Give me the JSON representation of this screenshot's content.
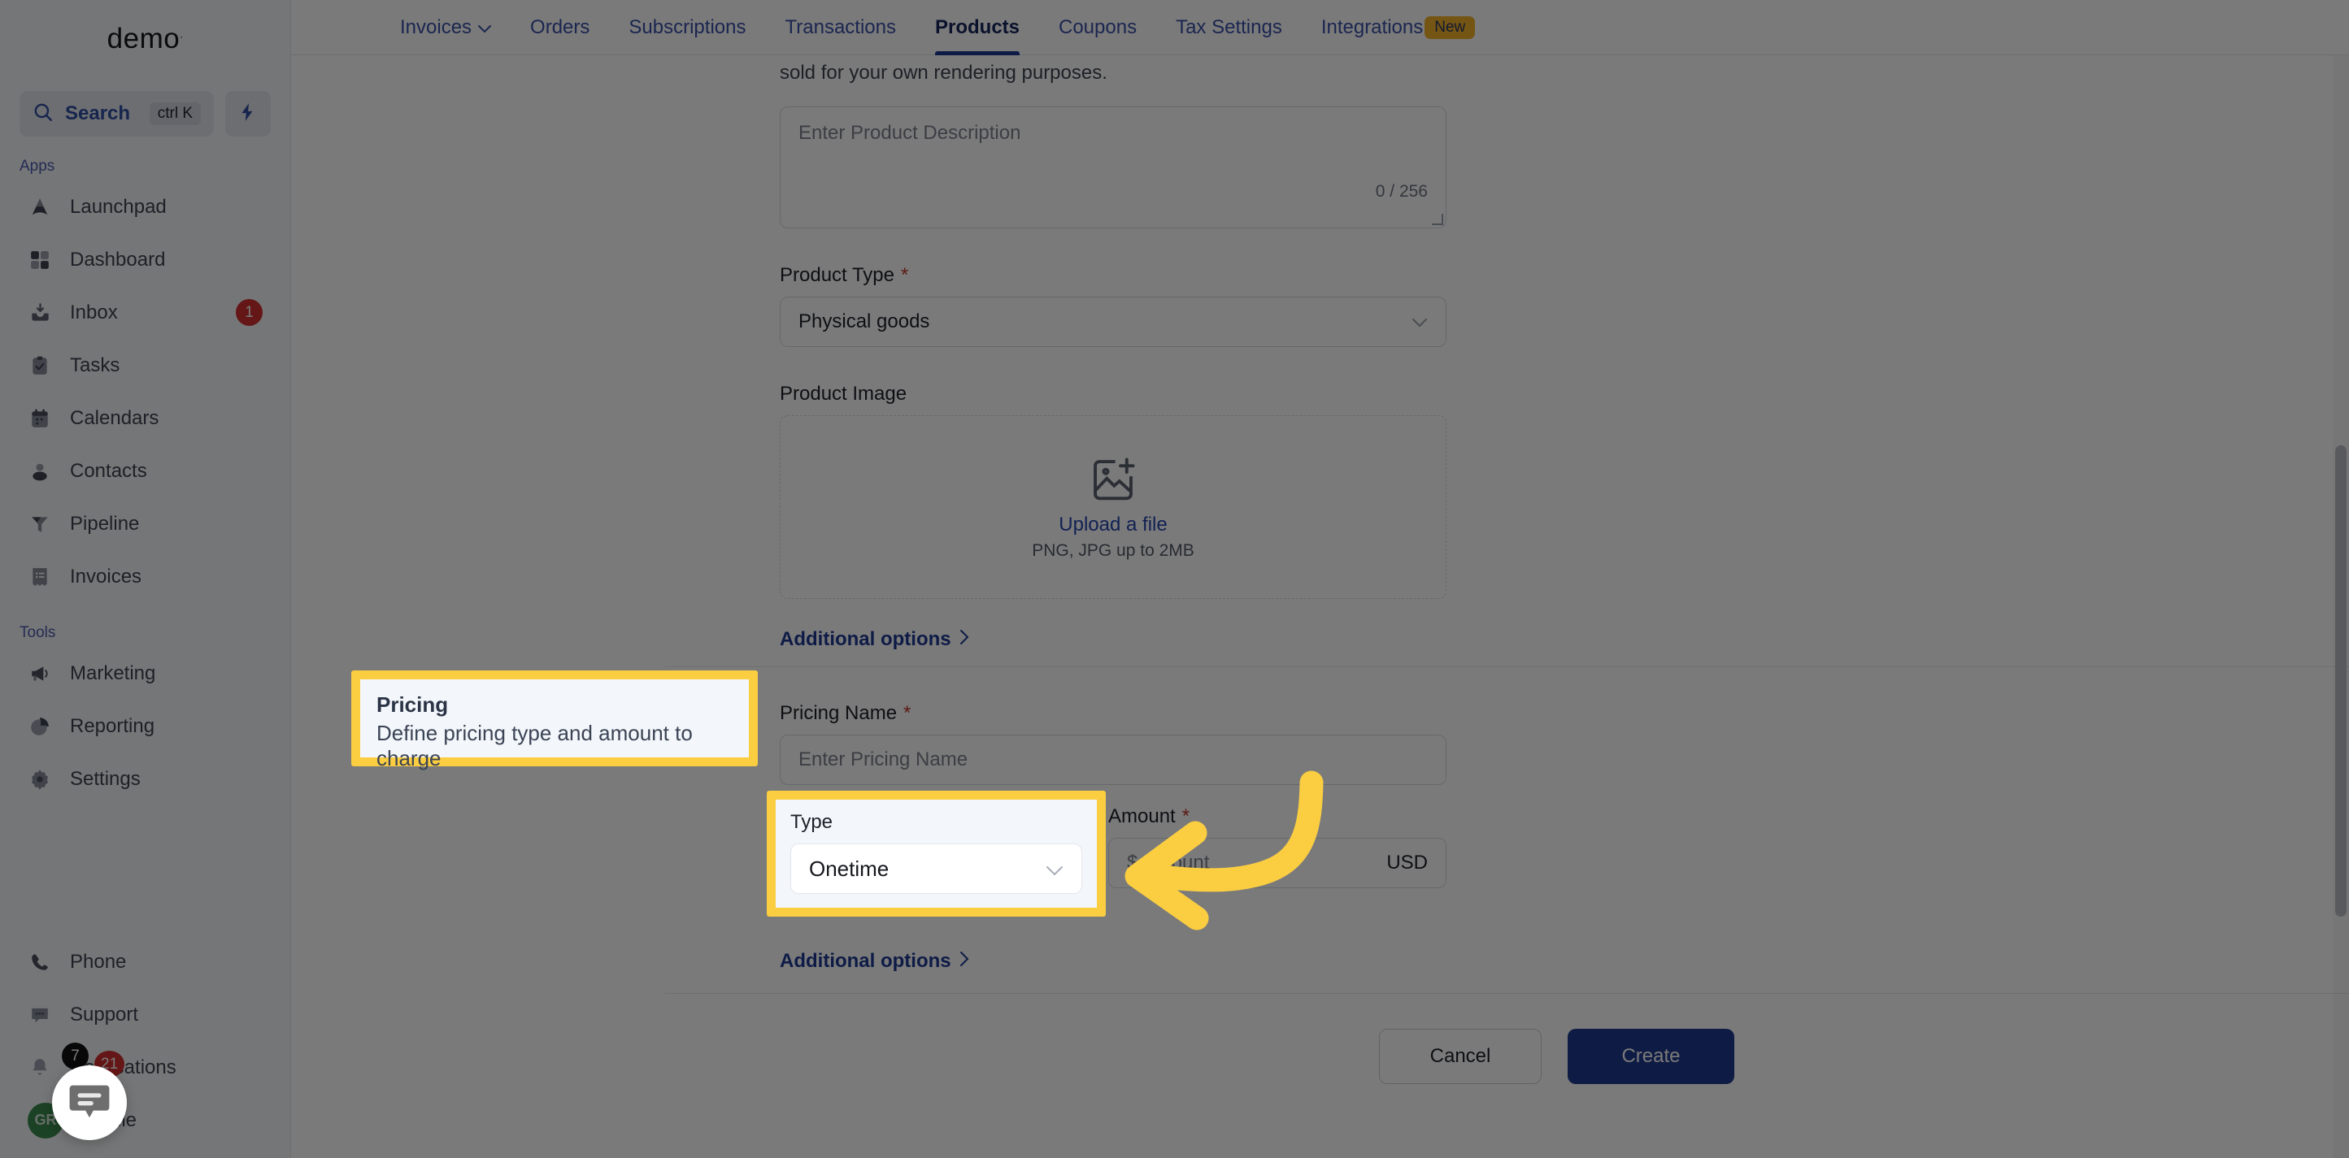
{
  "brand": {
    "name": "demo",
    "mark": "."
  },
  "sidebar": {
    "search": {
      "label": "Search",
      "shortcut": "ctrl K",
      "icon": "search-icon"
    },
    "quick_action_icon": "lightning-bolt-icon",
    "groups": [
      {
        "label": "Apps",
        "items": [
          {
            "label": "Launchpad",
            "icon": "launchpad-icon",
            "badge": ""
          },
          {
            "label": "Dashboard",
            "icon": "dashboard-grid-icon",
            "badge": ""
          },
          {
            "label": "Inbox",
            "icon": "inbox-icon",
            "badge": "1"
          },
          {
            "label": "Tasks",
            "icon": "clipboard-check-icon",
            "badge": ""
          },
          {
            "label": "Calendars",
            "icon": "calendar-icon",
            "badge": ""
          },
          {
            "label": "Contacts",
            "icon": "person-icon",
            "badge": ""
          },
          {
            "label": "Pipeline",
            "icon": "funnel-icon",
            "badge": ""
          },
          {
            "label": "Invoices",
            "icon": "invoice-list-icon",
            "badge": ""
          }
        ]
      },
      {
        "label": "Tools",
        "items": [
          {
            "label": "Marketing",
            "icon": "megaphone-icon",
            "badge": ""
          },
          {
            "label": "Reporting",
            "icon": "pie-chart-icon",
            "badge": ""
          },
          {
            "label": "Settings",
            "icon": "gear-icon",
            "badge": ""
          }
        ]
      }
    ],
    "bottom_items": [
      {
        "label": "Phone",
        "icon": "phone-icon",
        "badge": ""
      },
      {
        "label": "Support",
        "icon": "chat-bubble-icon",
        "badge": ""
      },
      {
        "label": "Notifications",
        "icon": "bell-icon",
        "badge": "21",
        "badge2": "7"
      }
    ],
    "profile": {
      "label": "Profile",
      "initials": "GR"
    },
    "chat_widget_icon": "chat-widget-icon"
  },
  "topnav": {
    "menu_icon": "hamburger-menu-icon",
    "tabs": [
      {
        "label": "Invoices",
        "active": false,
        "caret": true,
        "badge": ""
      },
      {
        "label": "Orders",
        "active": false,
        "caret": false,
        "badge": ""
      },
      {
        "label": "Subscriptions",
        "active": false,
        "caret": false,
        "badge": ""
      },
      {
        "label": "Transactions",
        "active": false,
        "caret": false,
        "badge": ""
      },
      {
        "label": "Products",
        "active": true,
        "caret": false,
        "badge": ""
      },
      {
        "label": "Coupons",
        "active": false,
        "caret": false,
        "badge": ""
      },
      {
        "label": "Tax Settings",
        "active": false,
        "caret": false,
        "badge": ""
      },
      {
        "label": "Integrations",
        "active": false,
        "caret": false,
        "badge": "New"
      }
    ]
  },
  "form": {
    "lead_text": "sold for your own rendering purposes.",
    "description": {
      "placeholder": "Enter Product Description",
      "value": "",
      "counter": "0 / 256"
    },
    "product_type": {
      "label": "Product Type",
      "required": "*",
      "value": "Physical goods"
    },
    "product_image": {
      "label": "Product Image",
      "icon": "image-plus-icon",
      "upload_link": "Upload a file",
      "hint": "PNG, JPG up to 2MB"
    },
    "additional_options_1": "Additional options",
    "pricing_name": {
      "label": "Pricing Name",
      "required": "*",
      "placeholder": "Enter Pricing Name",
      "value": ""
    },
    "amount": {
      "label": "Amount",
      "required": "*",
      "placeholder": "$ Amount",
      "value": "",
      "currency": "USD"
    },
    "additional_options_2": "Additional options",
    "chevron_icon": "chevron-right-icon",
    "buttons": {
      "cancel": "Cancel",
      "create": "Create"
    }
  },
  "highlights": {
    "pricing_card": {
      "title": "Pricing",
      "subtitle": "Define pricing type and amount to charge"
    },
    "type_field": {
      "label": "Type",
      "value": "Onetime",
      "caret_icon": "chevron-down-icon"
    },
    "annotation_arrow_icon": "curved-arrow-pointing-left-icon"
  },
  "colors": {
    "highlight_yellow": "#fbce42",
    "primary_blue": "#1e3a8f",
    "link_blue": "#2546ad",
    "required_red": "#c0392b",
    "badge_red": "#d32f2f",
    "new_badge_yellow": "#f3b229",
    "overlay": "rgba(0,0,0,0.52)"
  }
}
